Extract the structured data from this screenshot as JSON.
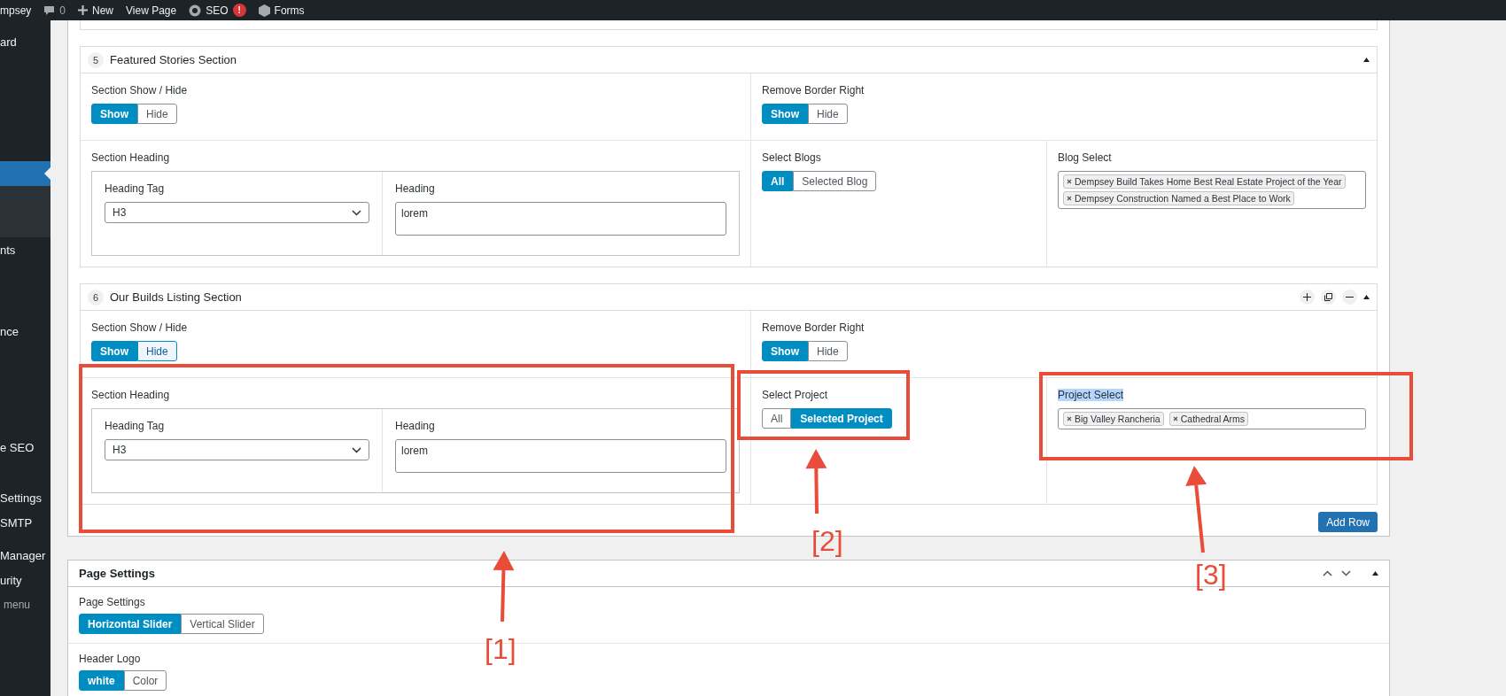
{
  "admin_bar": {
    "site": "mpsey",
    "comments": "0",
    "new": "New",
    "view_page": "View Page",
    "seo": "SEO",
    "seo_badge": "!",
    "forms": "Forms"
  },
  "sidebar": {
    "items": [
      {
        "label": "ard",
        "selected": false
      },
      {
        "selected": true
      },
      {
        "label": "nts",
        "selected": false
      },
      {
        "label": "nce",
        "selected": false
      },
      {
        "label": "e SEO",
        "selected": false
      },
      {
        "label": "Settings",
        "selected": false
      },
      {
        "label": "SMTP",
        "selected": false
      },
      {
        "label": "Manager",
        "selected": false
      },
      {
        "label": "urity",
        "selected": false
      },
      {
        "label": "menu",
        "selected": false,
        "kind": "collapse"
      }
    ]
  },
  "sections": [
    {
      "number": "5",
      "title": "Featured Stories Section",
      "row_controls": false,
      "show_hide": {
        "label": "Section Show / Hide",
        "options": [
          {
            "label": "Show",
            "selected": true,
            "focused": false
          },
          {
            "label": "Hide",
            "selected": false,
            "focused": false
          }
        ]
      },
      "border_right": {
        "label": "Remove Border Right",
        "options": [
          {
            "label": "Show",
            "selected": true,
            "focused": false
          },
          {
            "label": "Hide",
            "selected": false,
            "focused": false
          }
        ]
      },
      "heading": {
        "label": "Section Heading",
        "tag_label": "Heading Tag",
        "tag_value": "H3",
        "heading_label": "Heading",
        "heading_value": "lorem"
      },
      "select": {
        "label": "Select Blogs",
        "options": [
          {
            "label": "All",
            "selected": true,
            "focused": false
          },
          {
            "label": "Selected Blog",
            "selected": false,
            "focused": false
          }
        ]
      },
      "multi": {
        "label": "Blog Select",
        "highlighted": false,
        "tags": [
          "Dempsey Build Takes Home Best Real Estate Project of the Year",
          "Dempsey Construction Named a Best Place to Work"
        ]
      }
    },
    {
      "number": "6",
      "title": "Our Builds Listing Section",
      "row_controls": true,
      "show_hide": {
        "label": "Section Show / Hide",
        "options": [
          {
            "label": "Show",
            "selected": true,
            "focused": false
          },
          {
            "label": "Hide",
            "selected": false,
            "focused": true
          }
        ]
      },
      "border_right": {
        "label": "Remove Border Right",
        "options": [
          {
            "label": "Show",
            "selected": true,
            "focused": false
          },
          {
            "label": "Hide",
            "selected": false,
            "focused": false
          }
        ]
      },
      "heading": {
        "label": "Section Heading",
        "tag_label": "Heading Tag",
        "tag_value": "H3",
        "heading_label": "Heading",
        "heading_value": "lorem"
      },
      "select": {
        "label": "Select Project",
        "options": [
          {
            "label": "All",
            "selected": false,
            "focused": false
          },
          {
            "label": "Selected Project",
            "selected": true,
            "focused": false
          }
        ]
      },
      "multi": {
        "label": "Project Select",
        "highlighted": true,
        "tags": [
          "Big Valley Rancheria",
          "Cathedral Arms"
        ]
      }
    }
  ],
  "add_row": "Add Row",
  "page_settings": {
    "title": "Page Settings",
    "fields": [
      {
        "label": "Page Settings",
        "options": [
          {
            "label": "Horizontal Slider",
            "selected": true,
            "focused": false
          },
          {
            "label": "Vertical Slider",
            "selected": false,
            "focused": false
          }
        ]
      },
      {
        "label": "Header Logo",
        "options": [
          {
            "label": "white",
            "selected": true,
            "focused": false
          },
          {
            "label": "Color",
            "selected": false,
            "focused": false
          }
        ]
      }
    ]
  },
  "annotations": [
    {
      "label": "[1]"
    },
    {
      "label": "[2]"
    },
    {
      "label": "[3]"
    }
  ]
}
